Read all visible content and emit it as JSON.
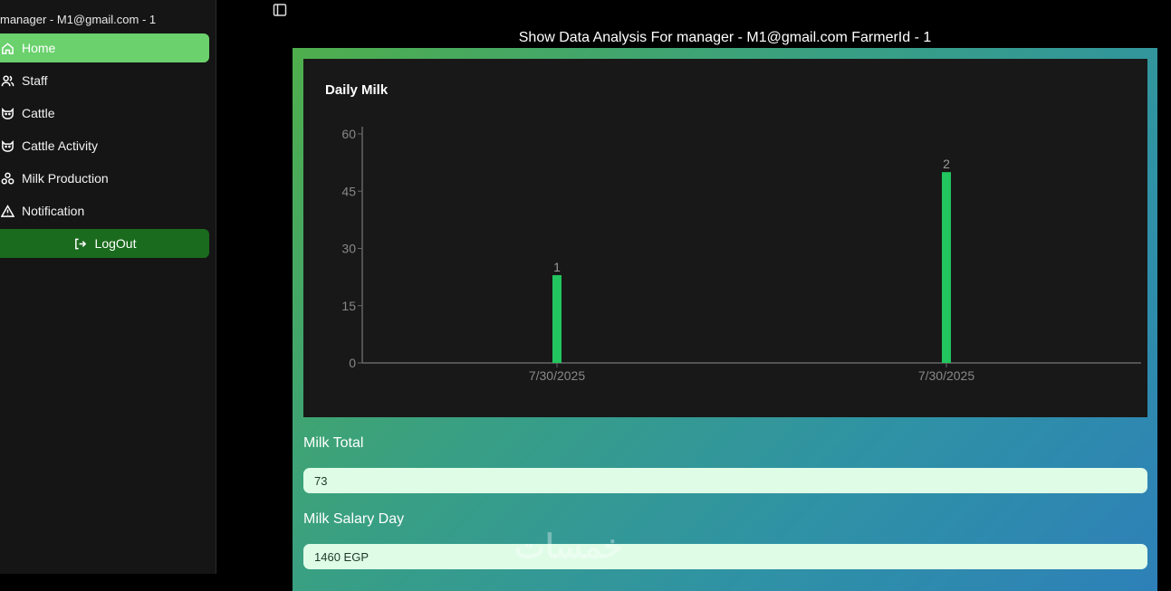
{
  "sidebar": {
    "user_line": "manager - M1@gmail.com - 1",
    "items": [
      {
        "label": "Home",
        "icon": "home-icon",
        "active": true
      },
      {
        "label": "Staff",
        "icon": "users-icon",
        "active": false
      },
      {
        "label": "Cattle",
        "icon": "cattle-icon",
        "active": false
      },
      {
        "label": "Cattle Activity",
        "icon": "cattle-icon",
        "active": false
      },
      {
        "label": "Milk Production",
        "icon": "milk-icon",
        "active": false
      },
      {
        "label": "Notification",
        "icon": "warning-icon",
        "active": false
      }
    ],
    "logout_label": "LogOut"
  },
  "header": {
    "title": "Show Data Analysis For manager - M1@gmail.com FarmerId - 1"
  },
  "chart_data": {
    "type": "bar",
    "title": "Daily Milk",
    "categories": [
      "7/30/2025",
      "7/30/2025"
    ],
    "values": [
      23,
      50
    ],
    "data_labels": [
      "1",
      "2"
    ],
    "ylim": [
      0,
      60
    ],
    "yticks": [
      0,
      15,
      30,
      45,
      60
    ],
    "xlabel": "",
    "ylabel": "",
    "grid": false,
    "bar_color": "#22c55e"
  },
  "fields": [
    {
      "label": "Milk Total",
      "value": "73"
    },
    {
      "label": "Milk Salary Day",
      "value": "1460 EGP"
    }
  ],
  "colors": {
    "active_nav": "#6ad16d",
    "logout": "#1b6b1e",
    "field_bg": "#dffce7"
  },
  "watermark": "خمسات"
}
